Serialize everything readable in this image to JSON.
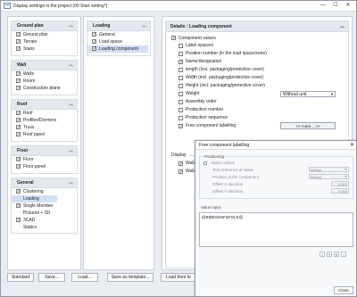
{
  "window": {
    "title": "Display settings in the project (00 Start setting*)",
    "controls": {
      "minimize": "—",
      "maximize": "☐",
      "close": "✕"
    }
  },
  "left_column": {
    "sections": [
      {
        "title": "Ground plan",
        "items": [
          {
            "label": "Ground plan",
            "checked": true
          },
          {
            "label": "Terrain",
            "checked": true
          },
          {
            "label": "Stairs",
            "checked": true
          }
        ]
      },
      {
        "title": "Wall",
        "items": [
          {
            "label": "Walls",
            "checked": true
          },
          {
            "label": "Room",
            "checked": true
          },
          {
            "label": "Construction plane",
            "checked": true
          }
        ]
      },
      {
        "title": "Roof",
        "items": [
          {
            "label": "Roof",
            "checked": true
          },
          {
            "label": "Profiles/Dormers",
            "checked": true
          },
          {
            "label": "Truss",
            "checked": true
          },
          {
            "label": "Roof panel",
            "checked": true
          }
        ]
      },
      {
        "title": "Floor",
        "items": [
          {
            "label": "Floor",
            "checked": true
          },
          {
            "label": "Floor panel",
            "checked": true
          }
        ]
      },
      {
        "title": "General",
        "items": [
          {
            "label": "Clustering",
            "checked": true
          },
          {
            "label": "Loading",
            "checked": false,
            "selected": true
          },
          {
            "label": "Single Member",
            "checked": true
          },
          {
            "label": "Pictures + 3D",
            "checked": false
          },
          {
            "label": "3CAD",
            "checked": true
          },
          {
            "label": "Statics",
            "checked": false
          }
        ]
      }
    ]
  },
  "mid_column": {
    "title": "Loading",
    "items": [
      {
        "label": "General",
        "checked": true
      },
      {
        "label": "Load space",
        "checked": true
      },
      {
        "label": "Loading component",
        "checked": true,
        "selected": true
      }
    ]
  },
  "details": {
    "title": "Details : Loading component",
    "group_label": "Component values",
    "options": [
      {
        "label": "Label spacers",
        "checked": false
      },
      {
        "label": "Position number (in the load space/zone)",
        "checked": false
      },
      {
        "label": "Name/designation",
        "checked": true
      },
      {
        "label": "length (incl. packaging/protective cover)",
        "checked": false
      },
      {
        "label": "Width (incl. packaging/protective cover)",
        "checked": false
      },
      {
        "label": "Height (incl. packaging/protective cover)",
        "checked": false
      },
      {
        "label": "Weight",
        "checked": false
      },
      {
        "label": "Assembly order",
        "checked": false
      },
      {
        "label": "Production number",
        "checked": false
      },
      {
        "label": "Production sequence",
        "checked": false
      },
      {
        "label": "Free component labelling",
        "checked": true
      }
    ],
    "weight_select": "Without unit",
    "more_button": ">> more... >>",
    "display_label": "Display",
    "display_items": [
      {
        "label": "Wall/Roof/"
      },
      {
        "label": "Wall/Roof"
      }
    ]
  },
  "footer": {
    "standard": "Standard",
    "save": "Save...",
    "load": "Load...",
    "save_template": "Save as template...",
    "load_template": "Load from te"
  },
  "dialog": {
    "title": "Free component labelling",
    "close_x": "✕",
    "positioning_label": "Positioning",
    "attach_values": "Attach values",
    "text_reference_label": "Text reference of value",
    "text_reference_value": "left/top",
    "position_component_label": "Position at the component",
    "position_component_value": "left/top",
    "offset_x_label": "Offset X direction",
    "offset_x_value": "0.000",
    "offset_y_label": "Offset Y direction",
    "offset_y_value": "0.000",
    "value_input_label": "Value input",
    "value_input_text": "@BIBESKNFSFOLE@",
    "close_button": "Close"
  }
}
